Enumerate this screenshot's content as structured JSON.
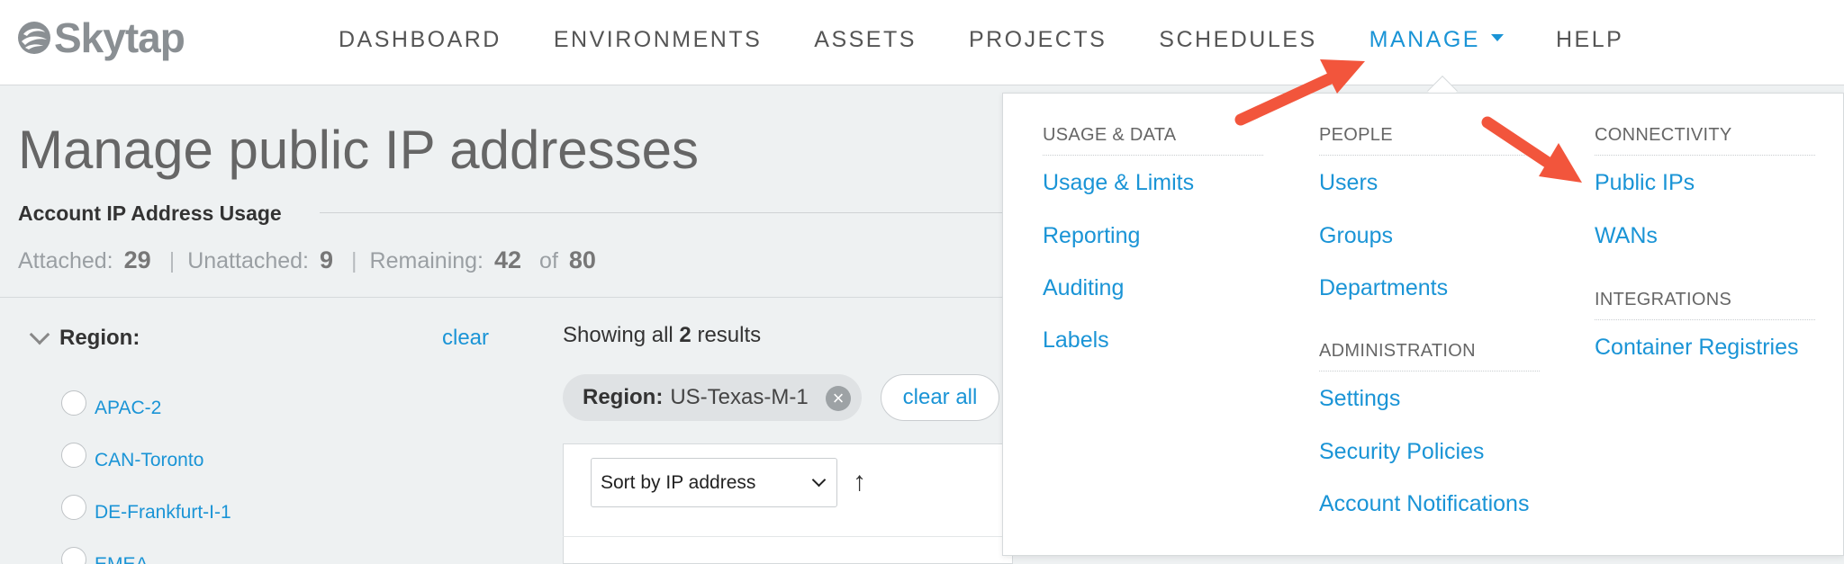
{
  "brand": {
    "name": "Skytap",
    "logo_icon": "skytap-swirl-icon"
  },
  "nav": {
    "items": [
      {
        "label": "DASHBOARD"
      },
      {
        "label": "ENVIRONMENTS"
      },
      {
        "label": "ASSETS"
      },
      {
        "label": "PROJECTS"
      },
      {
        "label": "SCHEDULES"
      },
      {
        "label": "MANAGE",
        "active": true
      },
      {
        "label": "HELP"
      }
    ]
  },
  "page": {
    "title": "Manage public IP addresses"
  },
  "usage": {
    "heading": "Account IP Address Usage",
    "attached_label": "Attached:",
    "attached_value": "29",
    "unattached_label": "Unattached:",
    "unattached_value": "9",
    "remaining_label": "Remaining:",
    "remaining_value": "42",
    "of_label": "of",
    "total_value": "80",
    "separator": "|"
  },
  "filters": {
    "region_label": "Region:",
    "clear_label": "clear",
    "regions": [
      "APAC-2",
      "CAN-Toronto",
      "DE-Frankfurt-I-1",
      "EMEA"
    ]
  },
  "results": {
    "showing_prefix": "Showing all",
    "count": "2",
    "showing_suffix": "results",
    "chip_label": "Region:",
    "chip_value": "US-Texas-M-1",
    "chip_remove": "×",
    "clear_all_label": "clear all",
    "sort_value": "Sort by IP address",
    "sort_direction": "↑"
  },
  "manage_menu": {
    "usage_data": {
      "heading": "USAGE & DATA",
      "items": [
        "Usage & Limits",
        "Reporting",
        "Auditing",
        "Labels"
      ]
    },
    "people": {
      "heading": "PEOPLE",
      "items": [
        "Users",
        "Groups",
        "Departments"
      ]
    },
    "administration": {
      "heading": "ADMINISTRATION",
      "items": [
        "Settings",
        "Security Policies",
        "Account Notifications"
      ]
    },
    "connectivity": {
      "heading": "CONNECTIVITY",
      "items": [
        "Public IPs",
        "WANs"
      ]
    },
    "integrations": {
      "heading": "INTEGRATIONS",
      "items": [
        "Container Registries"
      ]
    }
  },
  "colors": {
    "accent": "#1a94d6",
    "arrow": "#f2553c",
    "page_bg": "#eef1f2"
  }
}
